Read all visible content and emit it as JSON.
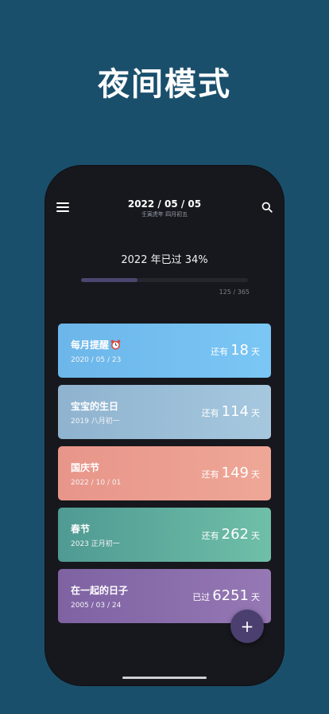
{
  "promo": {
    "headline": "夜间模式"
  },
  "header": {
    "date": "2022 / 05 / 05",
    "lunar": "壬寅虎年 四月初五"
  },
  "year_progress": {
    "label": "2022 年已过 34%",
    "percent": 34,
    "count_text": "125 / 365",
    "colors": {
      "fill": "#4a4670",
      "track": "#26272e"
    }
  },
  "cards": [
    {
      "title": "每月提醒",
      "icon": "alarm-clock-icon",
      "date": "2020 / 05 / 23",
      "prefix": "还有",
      "number": "18",
      "unit": "天",
      "color": "#6bb8ea"
    },
    {
      "title": "宝宝的生日",
      "date": "2019 八月初一",
      "prefix": "还有",
      "number": "114",
      "unit": "天",
      "color": "#8fb4cf"
    },
    {
      "title": "国庆节",
      "date": "2022 / 10 / 01",
      "prefix": "还有",
      "number": "149",
      "unit": "天",
      "color": "#e7988a"
    },
    {
      "title": "春节",
      "date": "2023 正月初一",
      "prefix": "还有",
      "number": "262",
      "unit": "天",
      "color": "#5aa598"
    },
    {
      "title": "在一起的日子",
      "date": "2005 / 03 / 24",
      "prefix": "已过",
      "number": "6251",
      "unit": "天",
      "color": "#8467a6"
    }
  ],
  "fab": {
    "label": "+",
    "color": "#4a3f6e"
  },
  "icons": {
    "menu": "hamburger-menu-icon",
    "search": "search-icon",
    "alarm": "alarm-clock-icon"
  },
  "theme": {
    "page_bg": "#1a4f6c",
    "phone_bg": "#17181d"
  }
}
